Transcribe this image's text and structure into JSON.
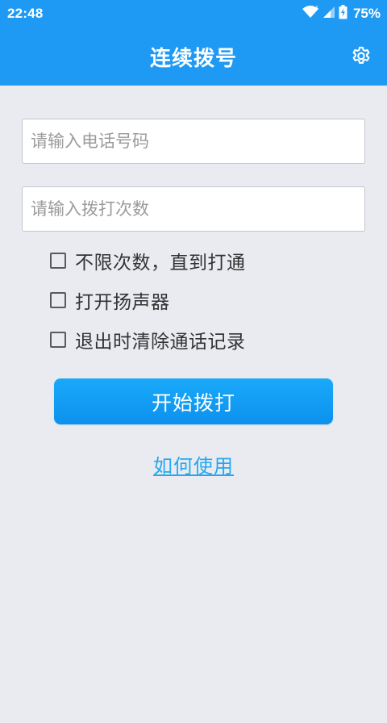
{
  "status_bar": {
    "time": "22:48",
    "battery_percent": "75%",
    "icons": [
      "wifi-icon",
      "signal-icon",
      "battery-icon"
    ]
  },
  "app_bar": {
    "title": "连续拨号",
    "settings_icon": "gear-icon"
  },
  "form": {
    "phone_placeholder": "请输入电话号码",
    "phone_value": "",
    "count_placeholder": "请输入拨打次数",
    "count_value": ""
  },
  "options": [
    {
      "label": "不限次数，直到打通",
      "checked": false
    },
    {
      "label": "打开扬声器",
      "checked": false
    },
    {
      "label": "退出时清除通话记录",
      "checked": false
    }
  ],
  "start_button_label": "开始拨打",
  "help_link_label": "如何使用",
  "colors": {
    "primary": "#1e9af5",
    "background": "#e9ebf1",
    "link": "#23a8f0"
  }
}
